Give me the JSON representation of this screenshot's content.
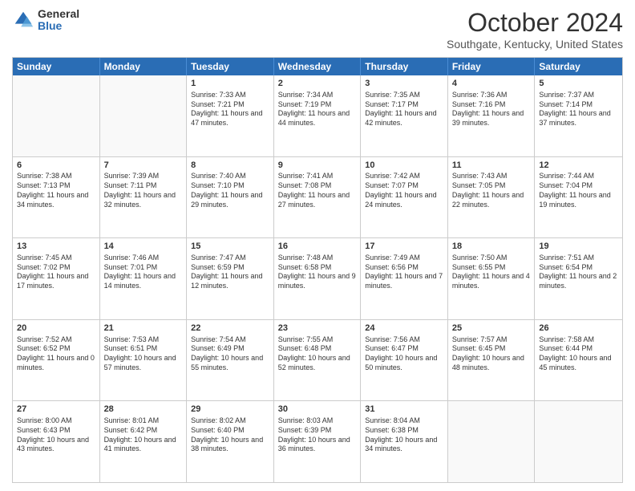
{
  "logo": {
    "general": "General",
    "blue": "Blue"
  },
  "title": "October 2024",
  "location": "Southgate, Kentucky, United States",
  "days_of_week": [
    "Sunday",
    "Monday",
    "Tuesday",
    "Wednesday",
    "Thursday",
    "Friday",
    "Saturday"
  ],
  "weeks": [
    [
      {
        "day": "",
        "sunrise": "",
        "sunset": "",
        "daylight": "",
        "empty": true
      },
      {
        "day": "",
        "sunrise": "",
        "sunset": "",
        "daylight": "",
        "empty": true
      },
      {
        "day": "1",
        "sunrise": "Sunrise: 7:33 AM",
        "sunset": "Sunset: 7:21 PM",
        "daylight": "Daylight: 11 hours and 47 minutes."
      },
      {
        "day": "2",
        "sunrise": "Sunrise: 7:34 AM",
        "sunset": "Sunset: 7:19 PM",
        "daylight": "Daylight: 11 hours and 44 minutes."
      },
      {
        "day": "3",
        "sunrise": "Sunrise: 7:35 AM",
        "sunset": "Sunset: 7:17 PM",
        "daylight": "Daylight: 11 hours and 42 minutes."
      },
      {
        "day": "4",
        "sunrise": "Sunrise: 7:36 AM",
        "sunset": "Sunset: 7:16 PM",
        "daylight": "Daylight: 11 hours and 39 minutes."
      },
      {
        "day": "5",
        "sunrise": "Sunrise: 7:37 AM",
        "sunset": "Sunset: 7:14 PM",
        "daylight": "Daylight: 11 hours and 37 minutes."
      }
    ],
    [
      {
        "day": "6",
        "sunrise": "Sunrise: 7:38 AM",
        "sunset": "Sunset: 7:13 PM",
        "daylight": "Daylight: 11 hours and 34 minutes."
      },
      {
        "day": "7",
        "sunrise": "Sunrise: 7:39 AM",
        "sunset": "Sunset: 7:11 PM",
        "daylight": "Daylight: 11 hours and 32 minutes."
      },
      {
        "day": "8",
        "sunrise": "Sunrise: 7:40 AM",
        "sunset": "Sunset: 7:10 PM",
        "daylight": "Daylight: 11 hours and 29 minutes."
      },
      {
        "day": "9",
        "sunrise": "Sunrise: 7:41 AM",
        "sunset": "Sunset: 7:08 PM",
        "daylight": "Daylight: 11 hours and 27 minutes."
      },
      {
        "day": "10",
        "sunrise": "Sunrise: 7:42 AM",
        "sunset": "Sunset: 7:07 PM",
        "daylight": "Daylight: 11 hours and 24 minutes."
      },
      {
        "day": "11",
        "sunrise": "Sunrise: 7:43 AM",
        "sunset": "Sunset: 7:05 PM",
        "daylight": "Daylight: 11 hours and 22 minutes."
      },
      {
        "day": "12",
        "sunrise": "Sunrise: 7:44 AM",
        "sunset": "Sunset: 7:04 PM",
        "daylight": "Daylight: 11 hours and 19 minutes."
      }
    ],
    [
      {
        "day": "13",
        "sunrise": "Sunrise: 7:45 AM",
        "sunset": "Sunset: 7:02 PM",
        "daylight": "Daylight: 11 hours and 17 minutes."
      },
      {
        "day": "14",
        "sunrise": "Sunrise: 7:46 AM",
        "sunset": "Sunset: 7:01 PM",
        "daylight": "Daylight: 11 hours and 14 minutes."
      },
      {
        "day": "15",
        "sunrise": "Sunrise: 7:47 AM",
        "sunset": "Sunset: 6:59 PM",
        "daylight": "Daylight: 11 hours and 12 minutes."
      },
      {
        "day": "16",
        "sunrise": "Sunrise: 7:48 AM",
        "sunset": "Sunset: 6:58 PM",
        "daylight": "Daylight: 11 hours and 9 minutes."
      },
      {
        "day": "17",
        "sunrise": "Sunrise: 7:49 AM",
        "sunset": "Sunset: 6:56 PM",
        "daylight": "Daylight: 11 hours and 7 minutes."
      },
      {
        "day": "18",
        "sunrise": "Sunrise: 7:50 AM",
        "sunset": "Sunset: 6:55 PM",
        "daylight": "Daylight: 11 hours and 4 minutes."
      },
      {
        "day": "19",
        "sunrise": "Sunrise: 7:51 AM",
        "sunset": "Sunset: 6:54 PM",
        "daylight": "Daylight: 11 hours and 2 minutes."
      }
    ],
    [
      {
        "day": "20",
        "sunrise": "Sunrise: 7:52 AM",
        "sunset": "Sunset: 6:52 PM",
        "daylight": "Daylight: 11 hours and 0 minutes."
      },
      {
        "day": "21",
        "sunrise": "Sunrise: 7:53 AM",
        "sunset": "Sunset: 6:51 PM",
        "daylight": "Daylight: 10 hours and 57 minutes."
      },
      {
        "day": "22",
        "sunrise": "Sunrise: 7:54 AM",
        "sunset": "Sunset: 6:49 PM",
        "daylight": "Daylight: 10 hours and 55 minutes."
      },
      {
        "day": "23",
        "sunrise": "Sunrise: 7:55 AM",
        "sunset": "Sunset: 6:48 PM",
        "daylight": "Daylight: 10 hours and 52 minutes."
      },
      {
        "day": "24",
        "sunrise": "Sunrise: 7:56 AM",
        "sunset": "Sunset: 6:47 PM",
        "daylight": "Daylight: 10 hours and 50 minutes."
      },
      {
        "day": "25",
        "sunrise": "Sunrise: 7:57 AM",
        "sunset": "Sunset: 6:45 PM",
        "daylight": "Daylight: 10 hours and 48 minutes."
      },
      {
        "day": "26",
        "sunrise": "Sunrise: 7:58 AM",
        "sunset": "Sunset: 6:44 PM",
        "daylight": "Daylight: 10 hours and 45 minutes."
      }
    ],
    [
      {
        "day": "27",
        "sunrise": "Sunrise: 8:00 AM",
        "sunset": "Sunset: 6:43 PM",
        "daylight": "Daylight: 10 hours and 43 minutes."
      },
      {
        "day": "28",
        "sunrise": "Sunrise: 8:01 AM",
        "sunset": "Sunset: 6:42 PM",
        "daylight": "Daylight: 10 hours and 41 minutes."
      },
      {
        "day": "29",
        "sunrise": "Sunrise: 8:02 AM",
        "sunset": "Sunset: 6:40 PM",
        "daylight": "Daylight: 10 hours and 38 minutes."
      },
      {
        "day": "30",
        "sunrise": "Sunrise: 8:03 AM",
        "sunset": "Sunset: 6:39 PM",
        "daylight": "Daylight: 10 hours and 36 minutes."
      },
      {
        "day": "31",
        "sunrise": "Sunrise: 8:04 AM",
        "sunset": "Sunset: 6:38 PM",
        "daylight": "Daylight: 10 hours and 34 minutes."
      },
      {
        "day": "",
        "sunrise": "",
        "sunset": "",
        "daylight": "",
        "empty": true
      },
      {
        "day": "",
        "sunrise": "",
        "sunset": "",
        "daylight": "",
        "empty": true
      }
    ]
  ]
}
